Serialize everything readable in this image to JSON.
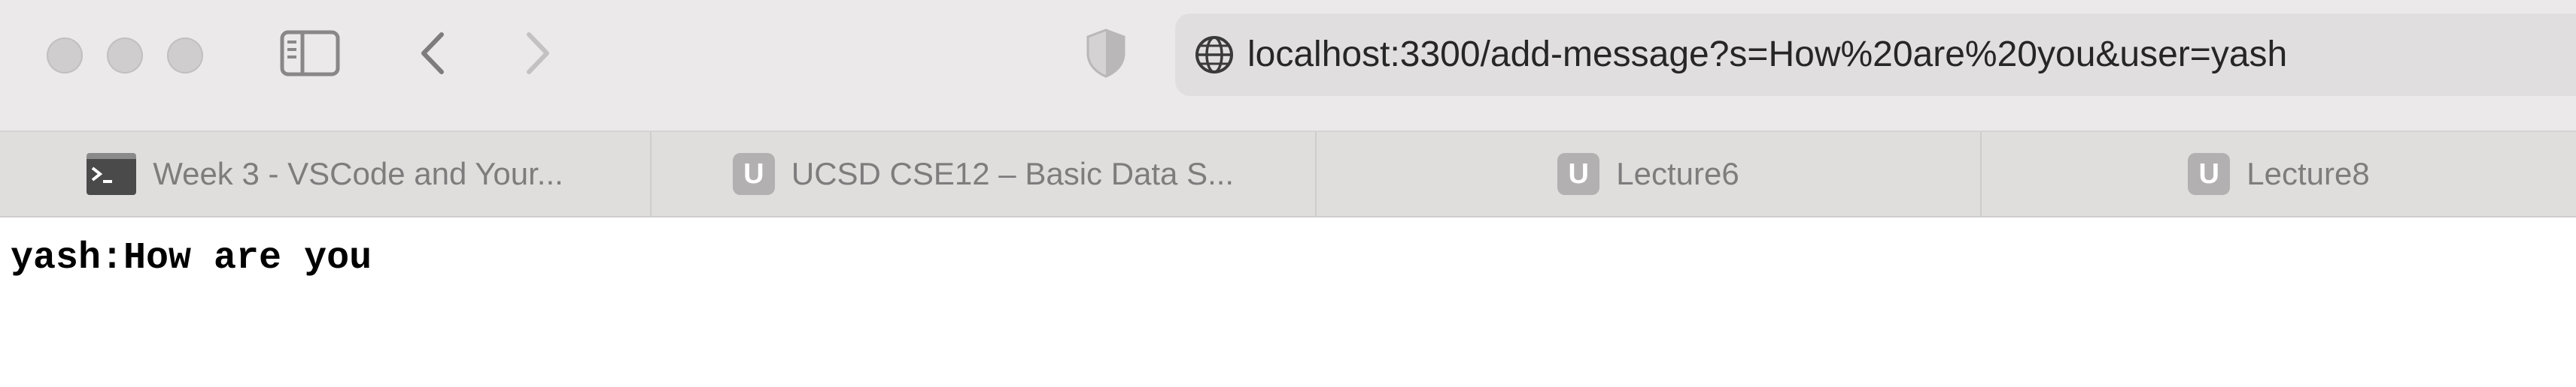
{
  "window": {
    "controls": [
      "close",
      "minimize",
      "zoom"
    ],
    "sidebar_icon": "sidebar-icon",
    "back_icon": "chevron-left-icon",
    "forward_icon": "chevron-right-icon",
    "privacy_icon": "shield-icon"
  },
  "address_bar": {
    "icon": "globe-icon",
    "url": "localhost:3300/add-message?s=How%20are%20you&user=yash"
  },
  "tabs": [
    {
      "label": "Week 3 - VSCode and Your...",
      "icon": "terminal-icon"
    },
    {
      "label": "UCSD CSE12 – Basic Data S...",
      "icon": "u-icon",
      "icon_text": "U"
    },
    {
      "label": "Lecture6",
      "icon": "u-icon",
      "icon_text": "U"
    },
    {
      "label": "Lecture8",
      "icon": "u-icon",
      "icon_text": "U"
    }
  ],
  "page": {
    "message": "yash:How are you"
  },
  "colors": {
    "toolbar_bg": "#ece9ea",
    "tabbar_bg": "#e0dddd",
    "urlbar_bg": "#e1dedf",
    "page_bg": "#ffffff"
  }
}
